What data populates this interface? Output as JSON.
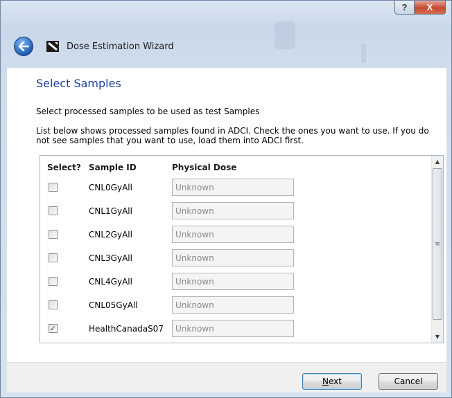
{
  "window": {
    "title": "Dose Estimation Wizard",
    "help_glyph": "?",
    "close_glyph": "X"
  },
  "page": {
    "heading": "Select Samples",
    "intro": "Select processed samples to be used as  test Samples",
    "description": "List below shows processed samples found in ADCI. Check the ones you want to use. If you do not see samples that you want to use, load them into ADCI first."
  },
  "table": {
    "headers": {
      "select": "Select?",
      "sample_id": "Sample ID",
      "physical_dose": "Physical Dose"
    },
    "rows": [
      {
        "sample_id": "CNL0GyAll",
        "dose": "Unknown",
        "checked": false
      },
      {
        "sample_id": "CNL1GyAll",
        "dose": "Unknown",
        "checked": false
      },
      {
        "sample_id": "CNL2GyAll",
        "dose": "Unknown",
        "checked": false
      },
      {
        "sample_id": "CNL3GyAll",
        "dose": "Unknown",
        "checked": false
      },
      {
        "sample_id": "CNL4GyAll",
        "dose": "Unknown",
        "checked": false
      },
      {
        "sample_id": "CNL05GyAll",
        "dose": "Unknown",
        "checked": false
      },
      {
        "sample_id": "HealthCanadaS07",
        "dose": "Unknown",
        "checked": true
      }
    ]
  },
  "buttons": {
    "next_mnemonic": "N",
    "next_rest": "ext",
    "cancel": "Cancel"
  },
  "colors": {
    "heading": "#1f3f9a",
    "frame": "#cfdcec"
  }
}
